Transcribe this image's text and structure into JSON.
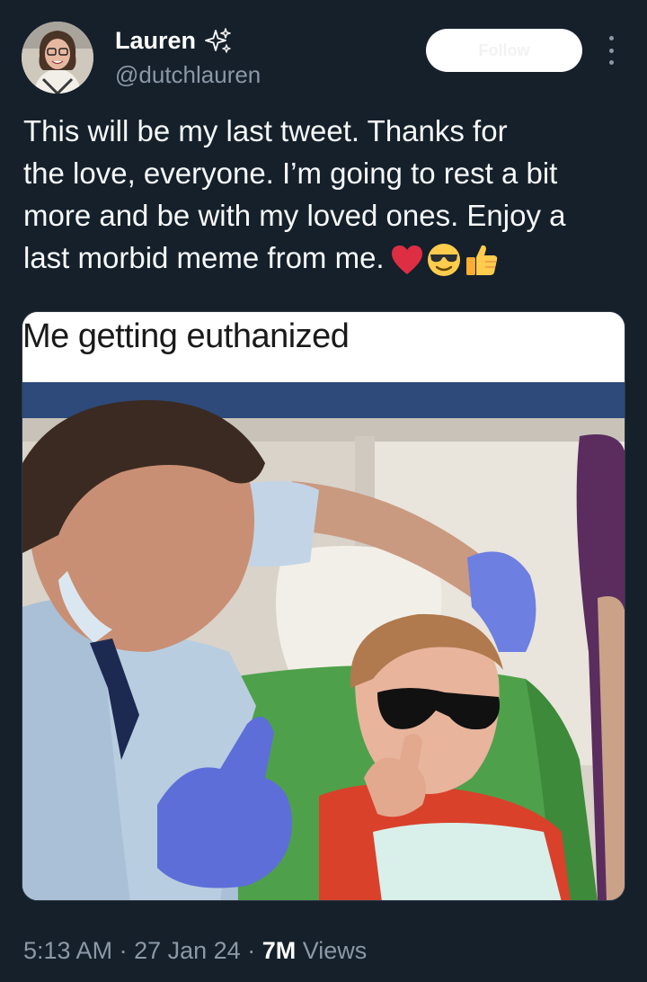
{
  "author": {
    "display_name": "Lauren",
    "handle": "@dutchlauren",
    "badge_icon": "sparkles-icon"
  },
  "follow_button": {
    "label": "Follow"
  },
  "tweet": {
    "text_lines": [
      "This will be my last tweet. Thanks for",
      "the love, everyone. I’m going to rest a bit",
      "more and be with my loved ones. Enjoy a",
      "last morbid meme from me."
    ],
    "emojis": [
      "red-heart-icon",
      "smiling-face-with-sunglasses-icon",
      "thumbs-up-icon"
    ]
  },
  "media": {
    "caption": "Me getting euthanized"
  },
  "meta": {
    "time": "5:13 AM",
    "separator": "·",
    "date": "27 Jan 24",
    "views_count": "7M",
    "views_label": "Views"
  },
  "colors": {
    "background": "#15202b",
    "text": "#f7f9f9",
    "secondary": "#8b98a5"
  }
}
